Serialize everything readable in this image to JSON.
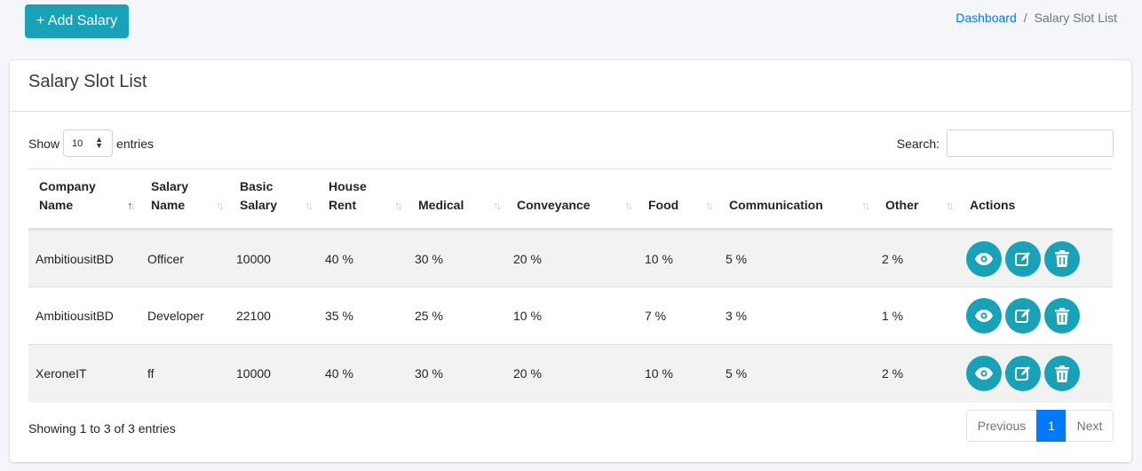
{
  "header": {
    "add_button": "+ Add Salary"
  },
  "breadcrumb": {
    "home": "Dashboard",
    "separator": "/",
    "current": "Salary Slot List"
  },
  "card": {
    "title": "Salary Slot List"
  },
  "controls": {
    "show_label": "Show",
    "length_value": "10",
    "entries_label": "entries",
    "search_label": "Search:",
    "search_value": ""
  },
  "table": {
    "columns": [
      [
        "Company",
        "Name"
      ],
      [
        "Salary",
        "Name"
      ],
      [
        "Basic",
        "Salary"
      ],
      [
        "House",
        "Rent"
      ],
      [
        "Medical"
      ],
      [
        "Conveyance"
      ],
      [
        "Food"
      ],
      [
        "Communication"
      ],
      [
        "Other"
      ],
      [
        "Actions"
      ]
    ],
    "rows": [
      [
        "AmbitiousitBD",
        "Officer",
        "10000",
        "40 %",
        "30 %",
        "20 %",
        "10 %",
        "5 %",
        "2 %"
      ],
      [
        "AmbitiousitBD",
        "Developer",
        "22100",
        "35 %",
        "25 %",
        "10 %",
        "7 %",
        "3 %",
        "1 %"
      ],
      [
        "XeroneIT",
        "ff",
        "10000",
        "40 %",
        "30 %",
        "20 %",
        "10 %",
        "5 %",
        "2 %"
      ]
    ],
    "row_actions": [
      "view-icon",
      "edit-icon",
      "delete-icon"
    ]
  },
  "footer": {
    "info": "Showing 1 to 3 of 3 entries",
    "prev": "Previous",
    "page": "1",
    "next": "Next"
  },
  "colors": {
    "accent": "#17a2b8",
    "link": "#007bff"
  }
}
